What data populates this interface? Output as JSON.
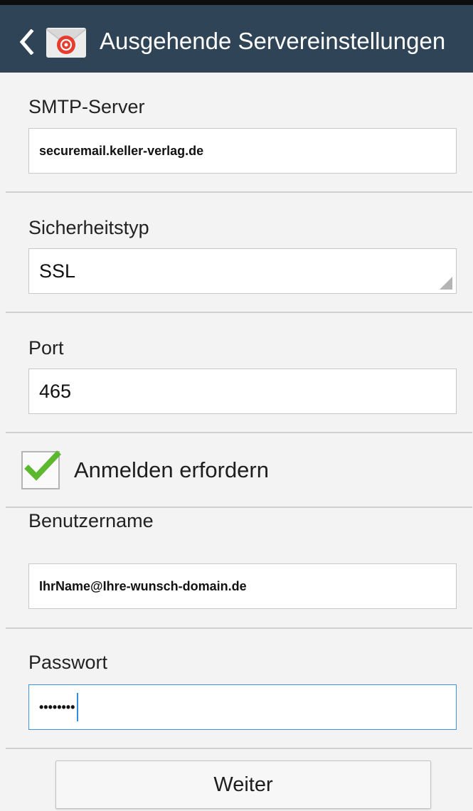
{
  "header": {
    "title": "Ausgehende Servereinstellungen",
    "back_icon": "chevron-left-icon",
    "app_icon": "email-app-icon",
    "background_color": "#2f4456"
  },
  "form": {
    "smtp_server": {
      "label": "SMTP-Server",
      "value": "securemail.keller-verlag.de"
    },
    "security_type": {
      "label": "Sicherheitstyp",
      "selected": "SSL"
    },
    "port": {
      "label": "Port",
      "value": "465"
    },
    "require_login": {
      "label": "Anmelden erfordern",
      "checked": true,
      "check_color": "#5cb82e"
    },
    "username": {
      "label": "Benutzername",
      "value": "IhrName@Ihre-wunsch-domain.de"
    },
    "password": {
      "label": "Passwort",
      "masked_value": "••••••••"
    }
  },
  "actions": {
    "next_label": "Weiter"
  },
  "colors": {
    "focus_border": "#3b95e0",
    "background": "#f3f3f3"
  }
}
